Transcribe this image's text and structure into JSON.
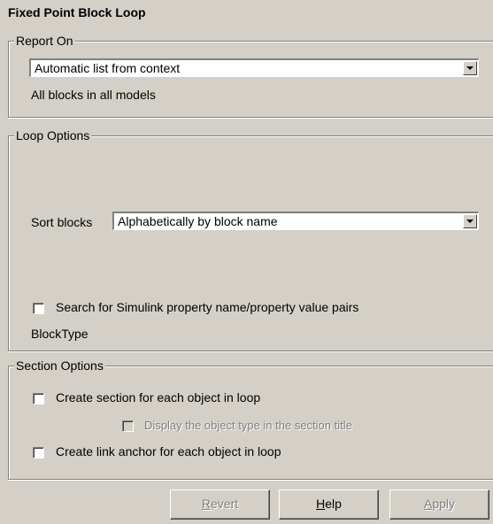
{
  "title": "Fixed Point Block Loop",
  "report_on": {
    "legend": "Report On",
    "selected": "Automatic list from context",
    "description": "All blocks in all models"
  },
  "loop_options": {
    "legend": "Loop Options",
    "sort_label": "Sort blocks",
    "sort_selected": "Alphabetically by block name",
    "search_checkbox_label": "Search for Simulink property name/property value pairs",
    "search_checked": false,
    "blocktype_text": "BlockType"
  },
  "section_options": {
    "legend": "Section Options",
    "create_section_label": "Create section for each object in loop",
    "create_section_checked": false,
    "display_type_label": "Display the object type in the section title",
    "display_type_checked": false,
    "create_anchor_label": "Create link anchor for each object in loop",
    "create_anchor_checked": false
  },
  "buttons": {
    "revert_first": "R",
    "revert_rest": "evert",
    "help_first": "H",
    "help_rest": "elp",
    "apply_first": "A",
    "apply_rest": "pply"
  }
}
